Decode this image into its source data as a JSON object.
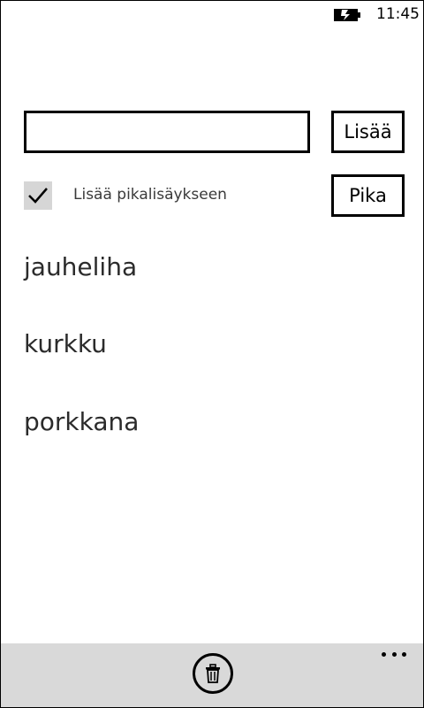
{
  "status_bar": {
    "time": "11:45",
    "battery_icon": "battery-charging-icon"
  },
  "form": {
    "input_value": "",
    "add_label": "Lisää",
    "quick_label": "Pika",
    "checkbox_label": "Lisää pikalisäykseen",
    "checkbox_checked": true
  },
  "list": {
    "items": [
      "jauheliha",
      "kurkku",
      "porkkana"
    ]
  },
  "app_bar": {
    "delete_icon": "trash-icon",
    "more_icon": "ellipsis-icon"
  }
}
